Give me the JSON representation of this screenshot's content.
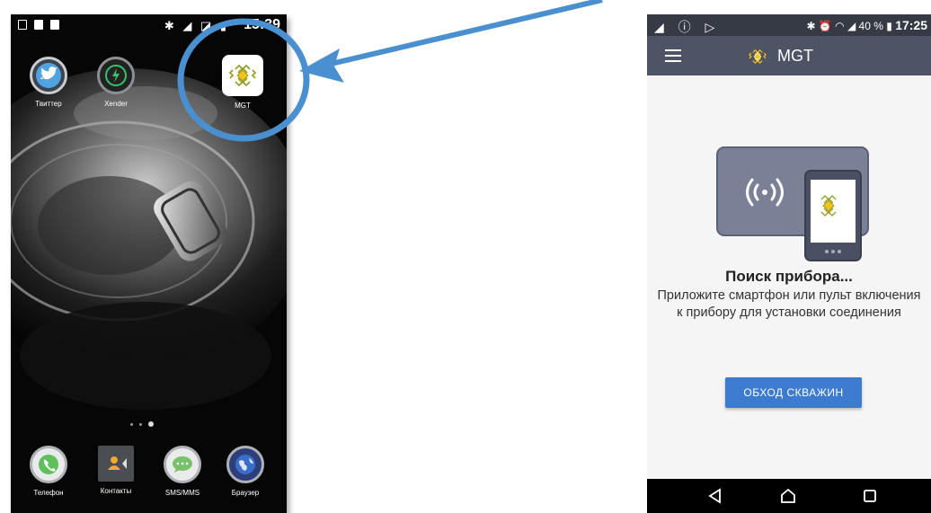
{
  "home": {
    "status": {
      "time": "15:39",
      "icons": "✱ ◢ ◪ ▮"
    },
    "apps_top": [
      {
        "label": "Твиттер"
      },
      {
        "label": "Xender"
      },
      {
        "label": "MGT"
      }
    ],
    "dock": [
      {
        "label": "Телефон"
      },
      {
        "label": "Контакты"
      },
      {
        "label": "SMS/MMS"
      },
      {
        "label": "Браузер"
      }
    ]
  },
  "app": {
    "status": {
      "left_icons": "◢ ⓘ ▷",
      "right_icons": "✱ ⏰ ◠ ◢",
      "battery": "40 %",
      "time": "17:25"
    },
    "title": "MGT",
    "search_title": "Поиск прибора...",
    "search_text": "Приложите смартфон или пульт включения к прибору для установки соединения",
    "bypass_button": "ОБХОД СКВАЖИН"
  },
  "colors": {
    "app_bar": "#4d5466",
    "status_bar": "#353a45",
    "button": "#3d7bd1",
    "highlight": "#4a90d0",
    "logo_yellow": "#f2c318",
    "logo_line": "#9aa028"
  }
}
